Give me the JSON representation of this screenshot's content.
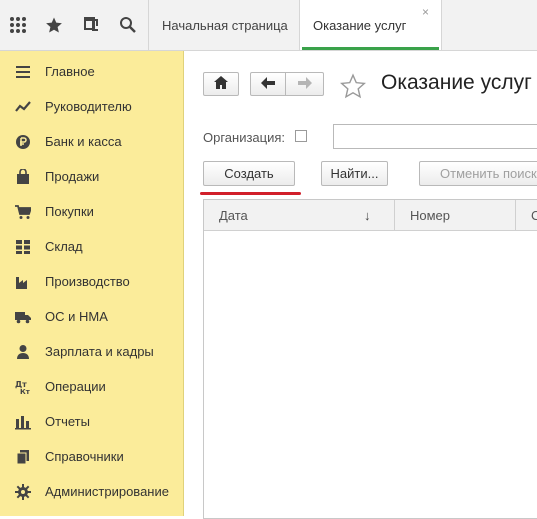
{
  "topbar": {
    "icons": [
      "apps-grid-icon",
      "star-icon",
      "history-icon",
      "search-icon"
    ],
    "tabs": [
      {
        "label": "Начальная страница"
      },
      {
        "label": "Оказание услуг",
        "close": "×"
      }
    ]
  },
  "sidebar": {
    "items": [
      {
        "label": "Главное",
        "icon": "menu-lines-icon"
      },
      {
        "label": "Руководителю",
        "icon": "trend-chart-icon"
      },
      {
        "label": "Банк и касса",
        "icon": "ruble-coin-icon"
      },
      {
        "label": "Продажи",
        "icon": "shopping-bag-icon"
      },
      {
        "label": "Покупки",
        "icon": "shopping-cart-icon"
      },
      {
        "label": "Склад",
        "icon": "warehouse-grid-icon"
      },
      {
        "label": "Производство",
        "icon": "factory-icon"
      },
      {
        "label": "ОС и НМА",
        "icon": "truck-icon"
      },
      {
        "label": "Зарплата и кадры",
        "icon": "person-icon"
      },
      {
        "label": "Операции",
        "icon": "debit-credit-icon"
      },
      {
        "label": "Отчеты",
        "icon": "bar-chart-icon"
      },
      {
        "label": "Справочники",
        "icon": "books-icon"
      },
      {
        "label": "Администрирование",
        "icon": "gear-icon"
      }
    ],
    "background": "#fbec9a"
  },
  "main": {
    "title": "Оказание услуг",
    "nav": {
      "home_icon": "home-icon",
      "back_icon": "arrow-left-icon",
      "forward_icon": "arrow-right-icon",
      "favorite_icon": "star-outline-icon"
    },
    "filter": {
      "label": "Организация:",
      "checked": false,
      "value": ""
    },
    "buttons": {
      "create": "Создать",
      "find": "Найти...",
      "cancel_search": "Отменить поиск"
    },
    "table": {
      "columns": [
        {
          "label": "Дата",
          "sort": "↓"
        },
        {
          "label": "Номер"
        },
        {
          "label": "С"
        }
      ],
      "rows": []
    },
    "accent": "#3aa24a",
    "highlight": "#d11f2a"
  }
}
